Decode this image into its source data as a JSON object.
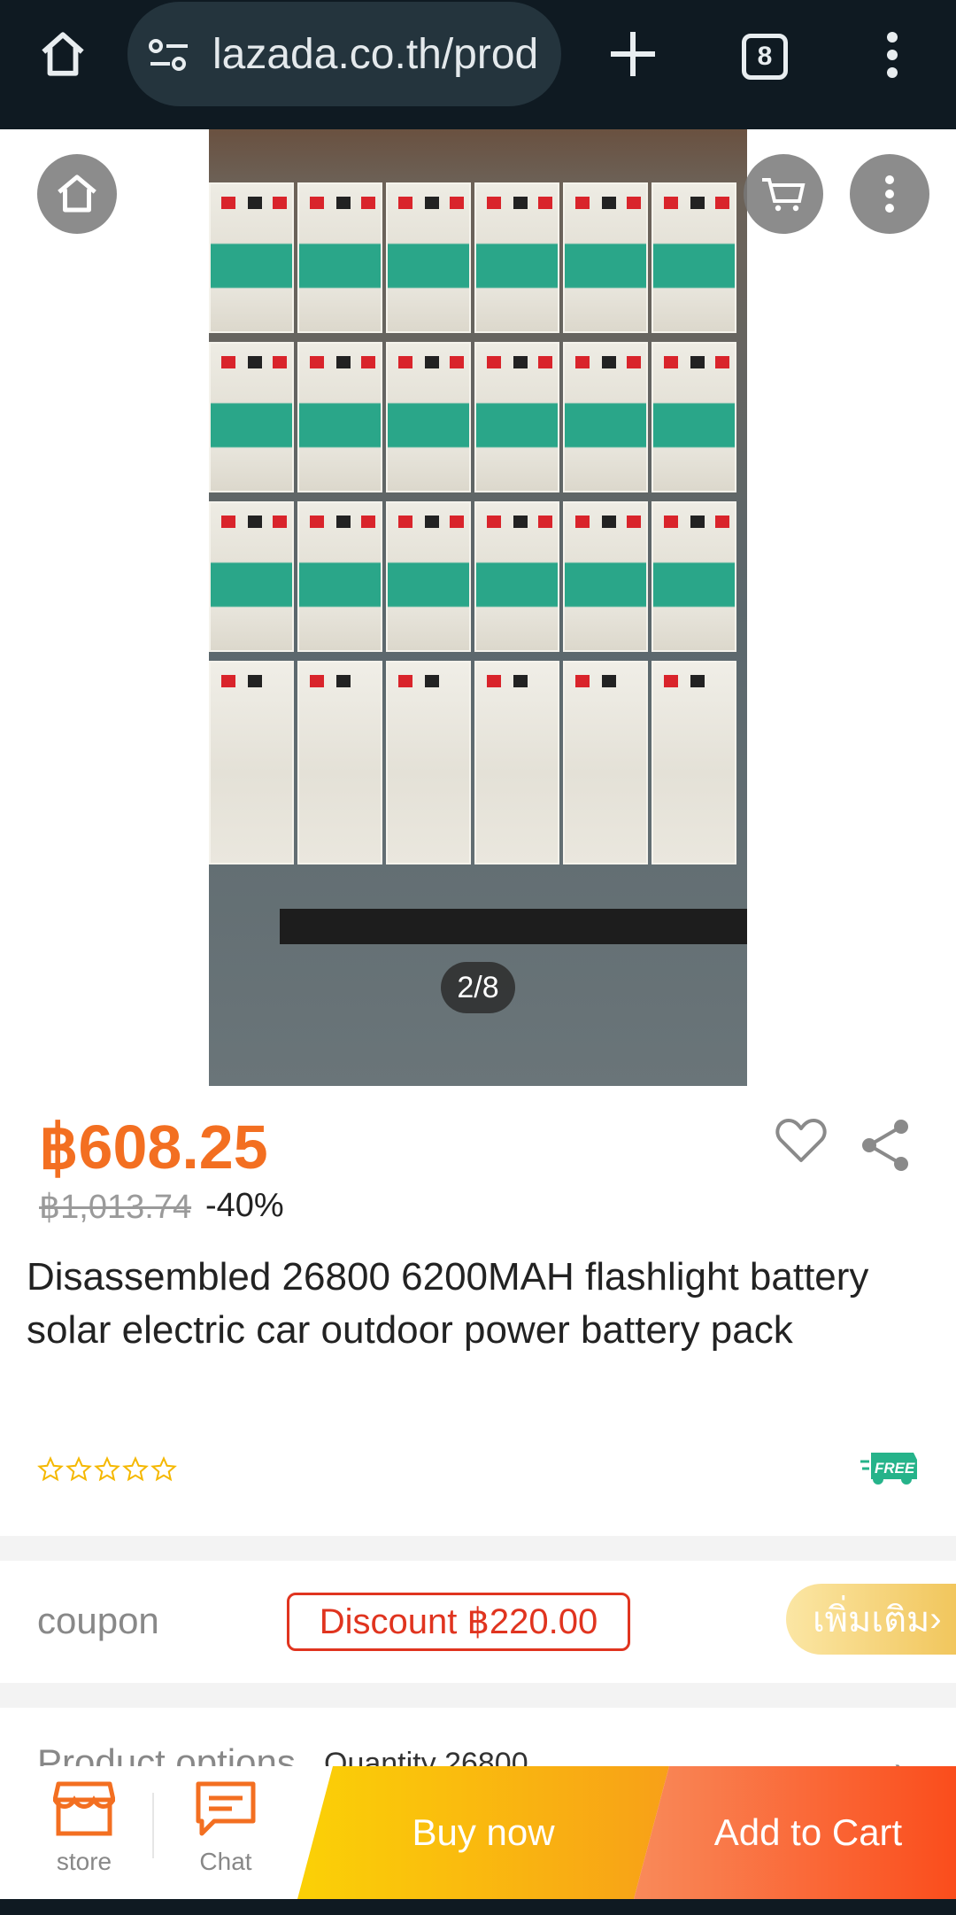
{
  "browser": {
    "url": "lazada.co.th/prod",
    "tab_count": "8",
    "icons": [
      "home-icon",
      "site-settings-icon",
      "plus-icon",
      "tabs-icon",
      "more-vert-icon"
    ]
  },
  "gallery": {
    "counter": "2/8",
    "icons": [
      "home-icon",
      "cart-icon",
      "more-icon"
    ]
  },
  "product": {
    "price": "฿608.25",
    "old_price": "฿1,013.74",
    "discount": "-40%",
    "title": "Disassembled 26800 6200MAH flashlight battery solar electric car outdoor power battery pack",
    "rating_stars": 0,
    "free_badge": "FREE"
  },
  "coupon": {
    "label": "coupon",
    "tag": "Discount ฿220.00",
    "more": "เพิ่มเติม"
  },
  "options": {
    "label": "Product options",
    "value": "Quantity 26800"
  },
  "bottom_bar": {
    "store_label": "store",
    "chat_label": "Chat",
    "buy_now": "Buy now",
    "add_to_cart": "Add to Cart"
  },
  "colors": {
    "accent": "#f36f21",
    "coupon_red": "#e0341f",
    "browser_bg": "#0f1a22",
    "buy_now_start": "#fbd106",
    "add_cart_end": "#fa4d1c"
  }
}
